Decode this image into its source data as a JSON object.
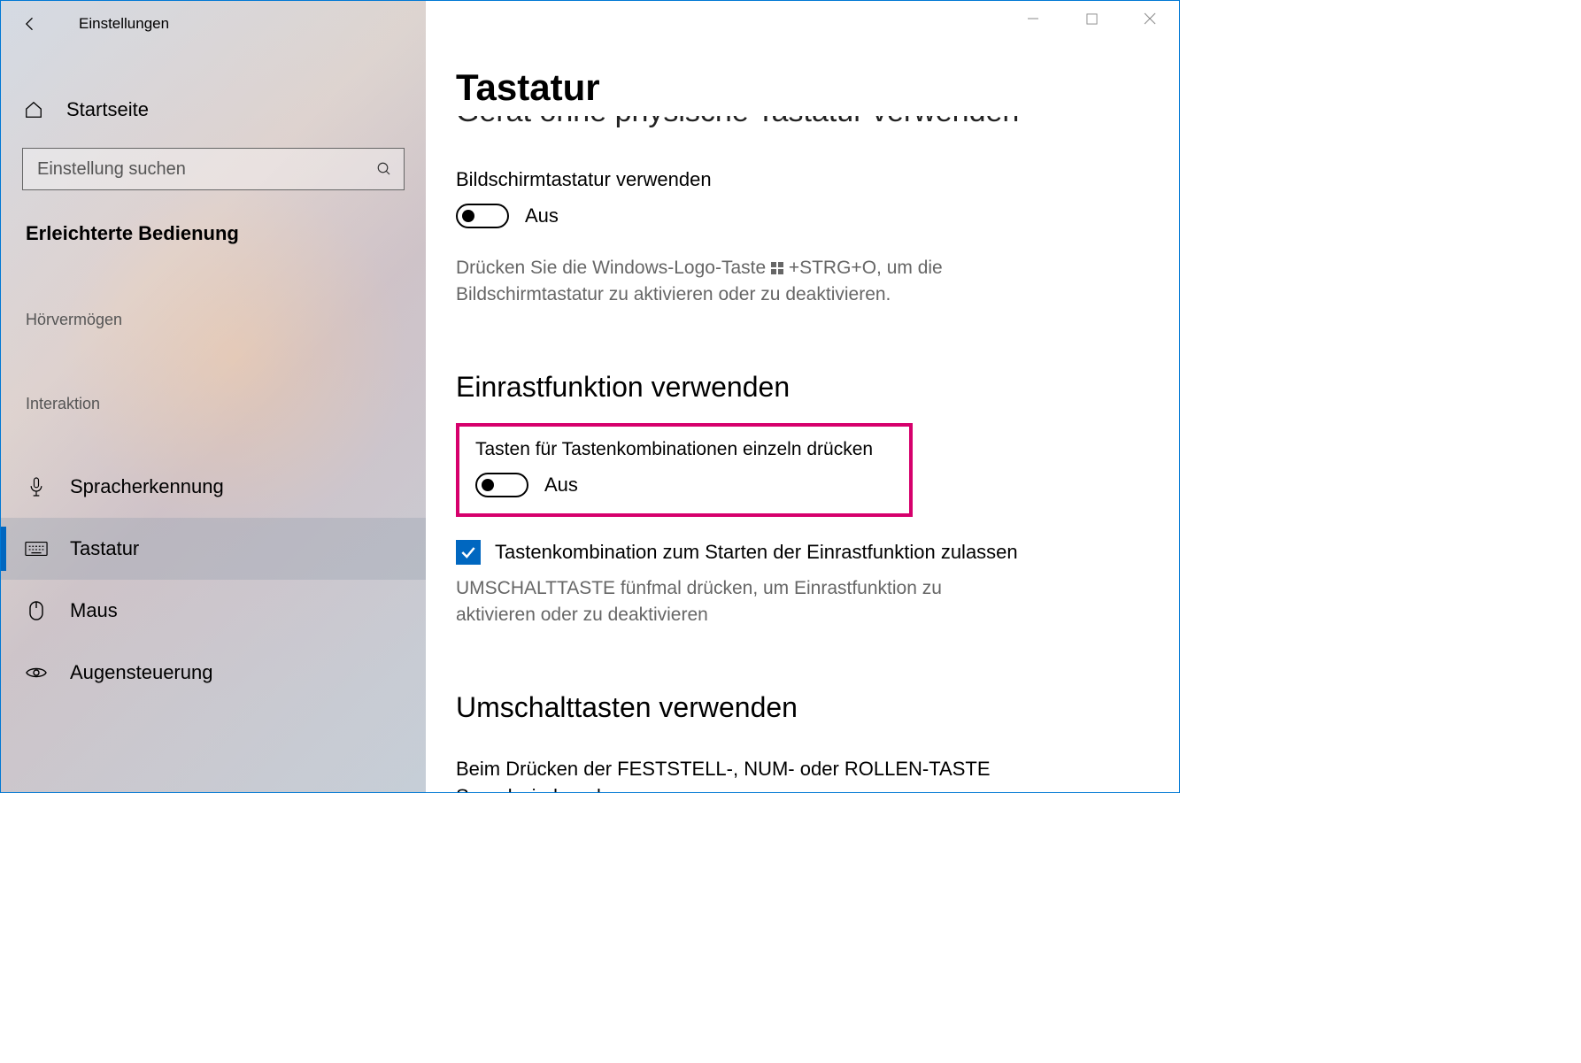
{
  "app_title": "Einstellungen",
  "sidebar": {
    "home_label": "Startseite",
    "search_placeholder": "Einstellung suchen",
    "section_label": "Erleichterte Bedienung",
    "group1_label": "Hörvermögen",
    "group2_label": "Interaktion",
    "items": [
      {
        "label": "Spracherkennung"
      },
      {
        "label": "Tastatur"
      },
      {
        "label": "Maus"
      },
      {
        "label": "Augensteuerung"
      }
    ]
  },
  "content": {
    "page_title": "Tastatur",
    "truncated_heading": "Gerät ohne physische Tastatur verwenden",
    "osk": {
      "label": "Bildschirmtastatur verwenden",
      "state": "Aus",
      "hint_pre": "Drücken Sie die Windows-Logo-Taste ",
      "hint_post": " +STRG+O, um die Bildschirmtastatur zu aktivieren oder zu deaktivieren."
    },
    "sticky": {
      "heading": "Einrastfunktion verwenden",
      "toggle_label": "Tasten für Tastenkombinationen einzeln drücken",
      "toggle_state": "Aus",
      "checkbox_label": "Tastenkombination zum Starten der Einrastfunktion zulassen",
      "checkbox_hint": "UMSCHALTTASTE fünfmal drücken, um Einrastfunktion zu aktivieren oder zu deaktivieren"
    },
    "toggle_keys": {
      "heading": "Umschalttasten verwenden",
      "label": "Beim Drücken der FESTSTELL-, NUM- oder ROLLEN-TASTE Sound wiedergeben"
    }
  }
}
